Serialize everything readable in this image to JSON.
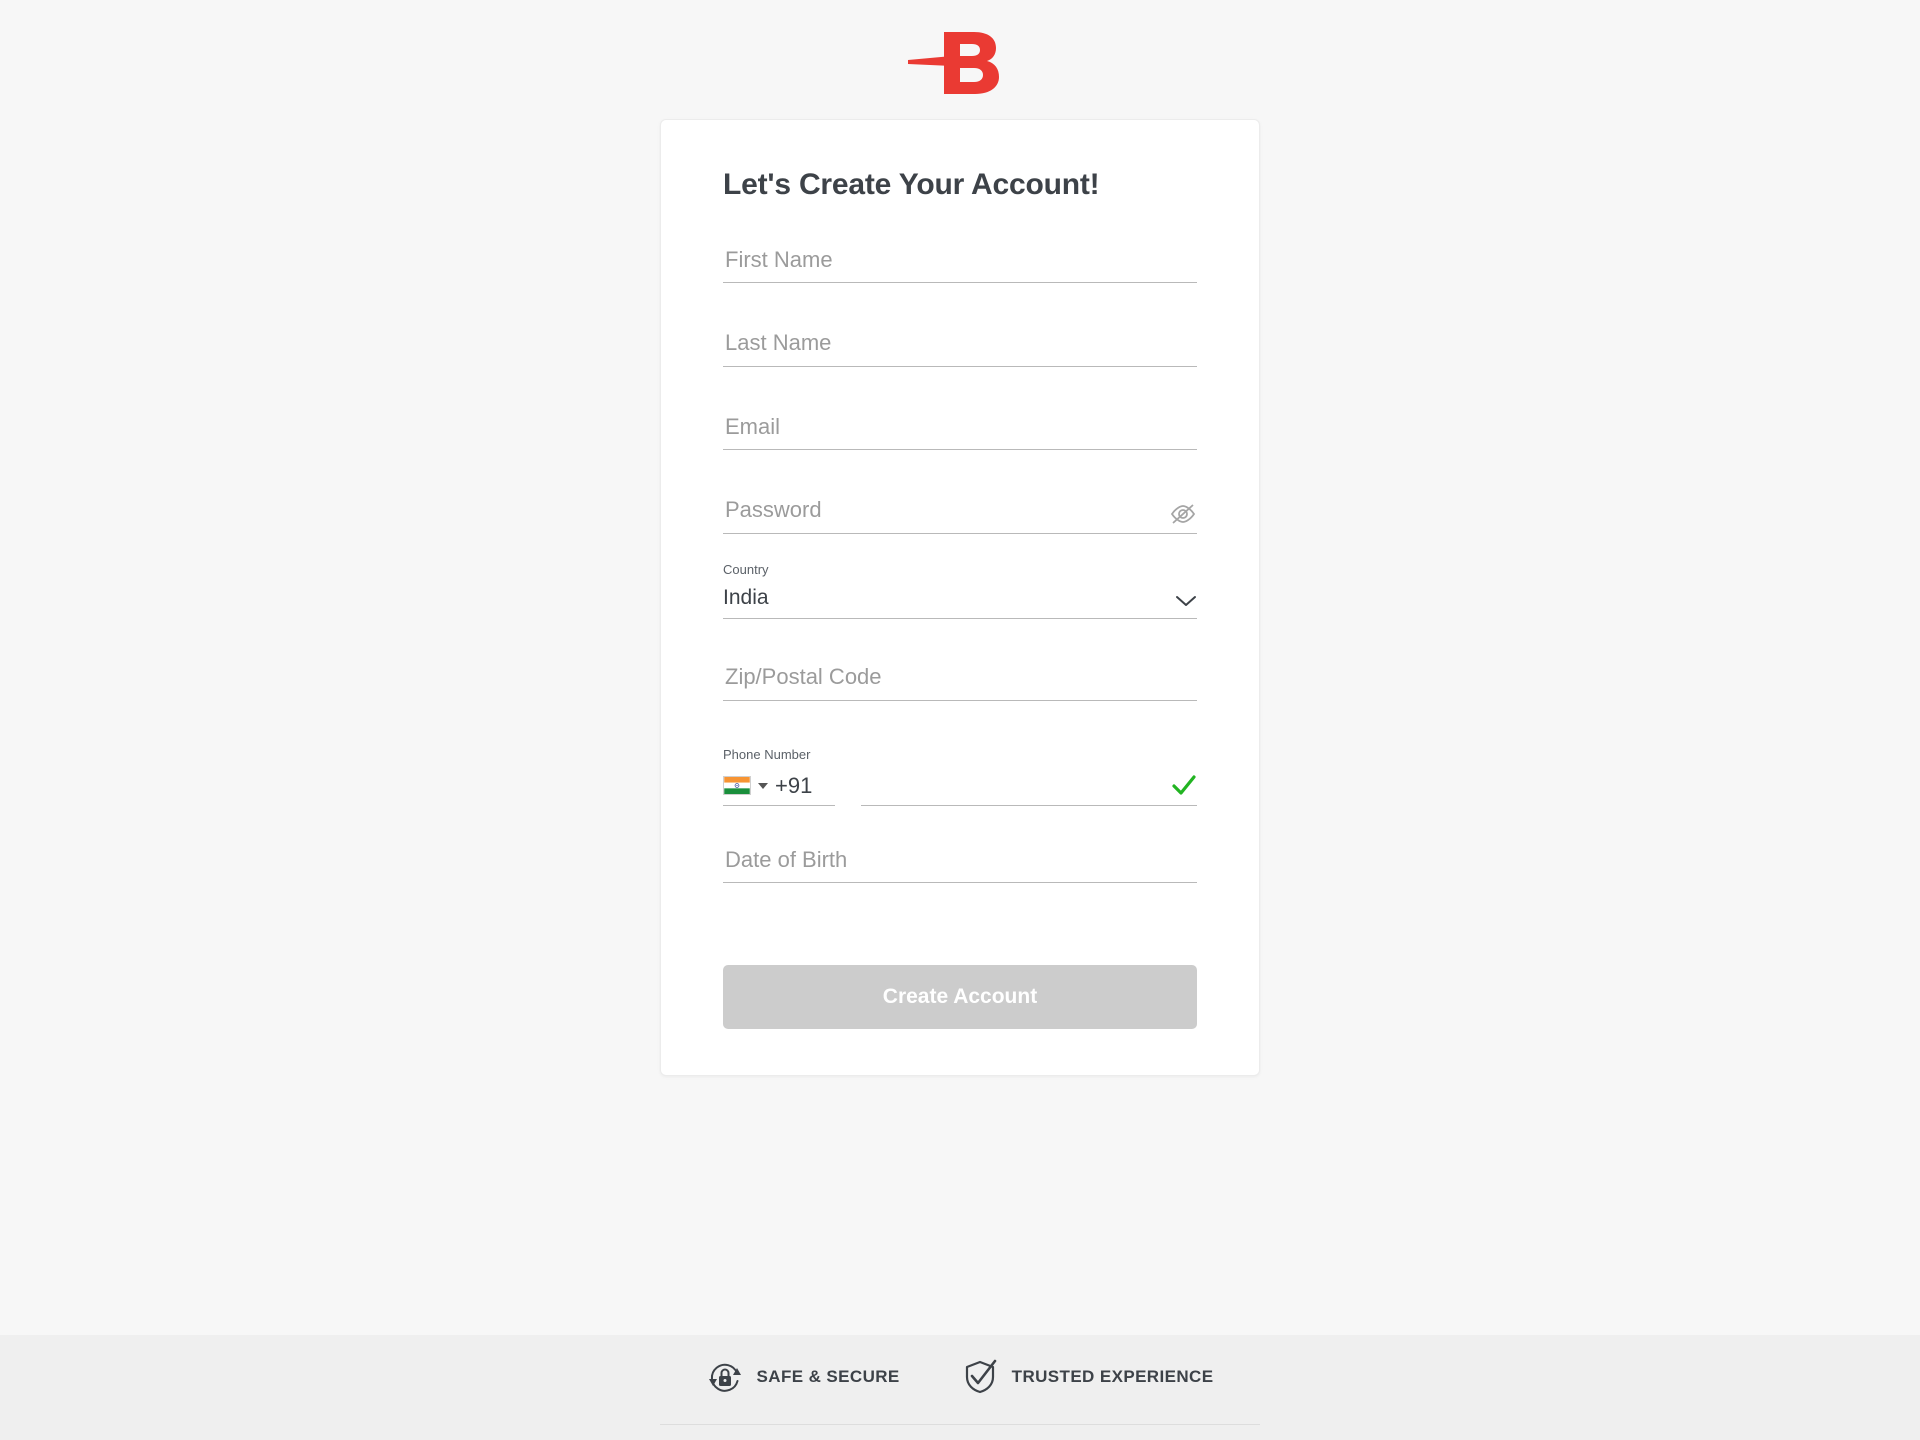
{
  "brand": {
    "logo_icon": "letter-b-logo",
    "logo_letter": "B",
    "logo_color": "#ea3a33"
  },
  "card": {
    "title": "Let's Create Your Account!",
    "fields": {
      "first_name": {
        "placeholder": "First Name",
        "value": ""
      },
      "last_name": {
        "placeholder": "Last Name",
        "value": ""
      },
      "email": {
        "placeholder": "Email",
        "value": ""
      },
      "password": {
        "placeholder": "Password",
        "value": "",
        "toggle_icon": "eye-off-icon"
      },
      "country": {
        "label": "Country",
        "value": "India",
        "dropdown_icon": "chevron-down-icon"
      },
      "zip": {
        "placeholder": "Zip/Postal Code",
        "value": ""
      },
      "phone": {
        "label": "Phone Number",
        "flag_icon": "india-flag-icon",
        "country_caret_icon": "caret-down-icon",
        "dial_code": "+91",
        "value": "",
        "placeholder": "",
        "valid_icon": "green-check-icon",
        "valid_color": "#22b422"
      },
      "date_of_birth": {
        "placeholder": "Date of Birth",
        "value": ""
      }
    },
    "submit": {
      "label": "Create Account",
      "disabled": true,
      "bg_color": "#cccccc"
    }
  },
  "footer": {
    "badges": [
      {
        "icon": "lock-secure-icon",
        "label": "SAFE & SECURE"
      },
      {
        "icon": "shield-check-icon",
        "label": "TRUSTED EXPERIENCE"
      }
    ]
  }
}
